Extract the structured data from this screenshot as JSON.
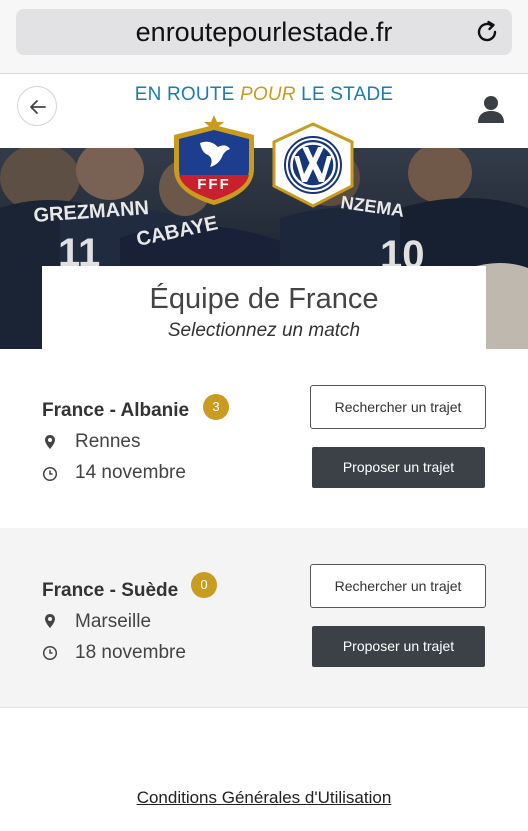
{
  "browser": {
    "url": "enroutepourlestade.fr",
    "reload_icon": "reload-icon"
  },
  "header": {
    "brand_part1": "EN ROUTE ",
    "brand_part2": "POUR",
    "brand_part3": " LE STADE",
    "back_icon": "arrow-left-icon",
    "user_icon": "user-icon"
  },
  "hero": {
    "logos": [
      "FFF",
      "Volkswagen"
    ],
    "fff_letters": "FFF",
    "jersey_names": [
      "GREZMANN",
      "CABAYE",
      "NZEMA"
    ],
    "jersey_numbers": [
      "11",
      "10"
    ]
  },
  "intro": {
    "title": "Équipe de France",
    "subtitle": "Selectionnez un match"
  },
  "matches": [
    {
      "name": "France - Albanie",
      "count": "3",
      "city": "Rennes",
      "date": "14 novembre",
      "search_label": "Rechercher un trajet",
      "propose_label": "Proposer un trajet"
    },
    {
      "name": "France - Suède",
      "count": "0",
      "city": "Marseille",
      "date": "18 novembre",
      "search_label": "Rechercher un trajet",
      "propose_label": "Proposer un trajet"
    }
  ],
  "footer": {
    "cgu_link": "Conditions Générales d'Utilisation"
  },
  "colors": {
    "brand_blue": "#1a7cb3",
    "accent_gold": "#c99b1e",
    "button_dark": "#3c4148"
  }
}
